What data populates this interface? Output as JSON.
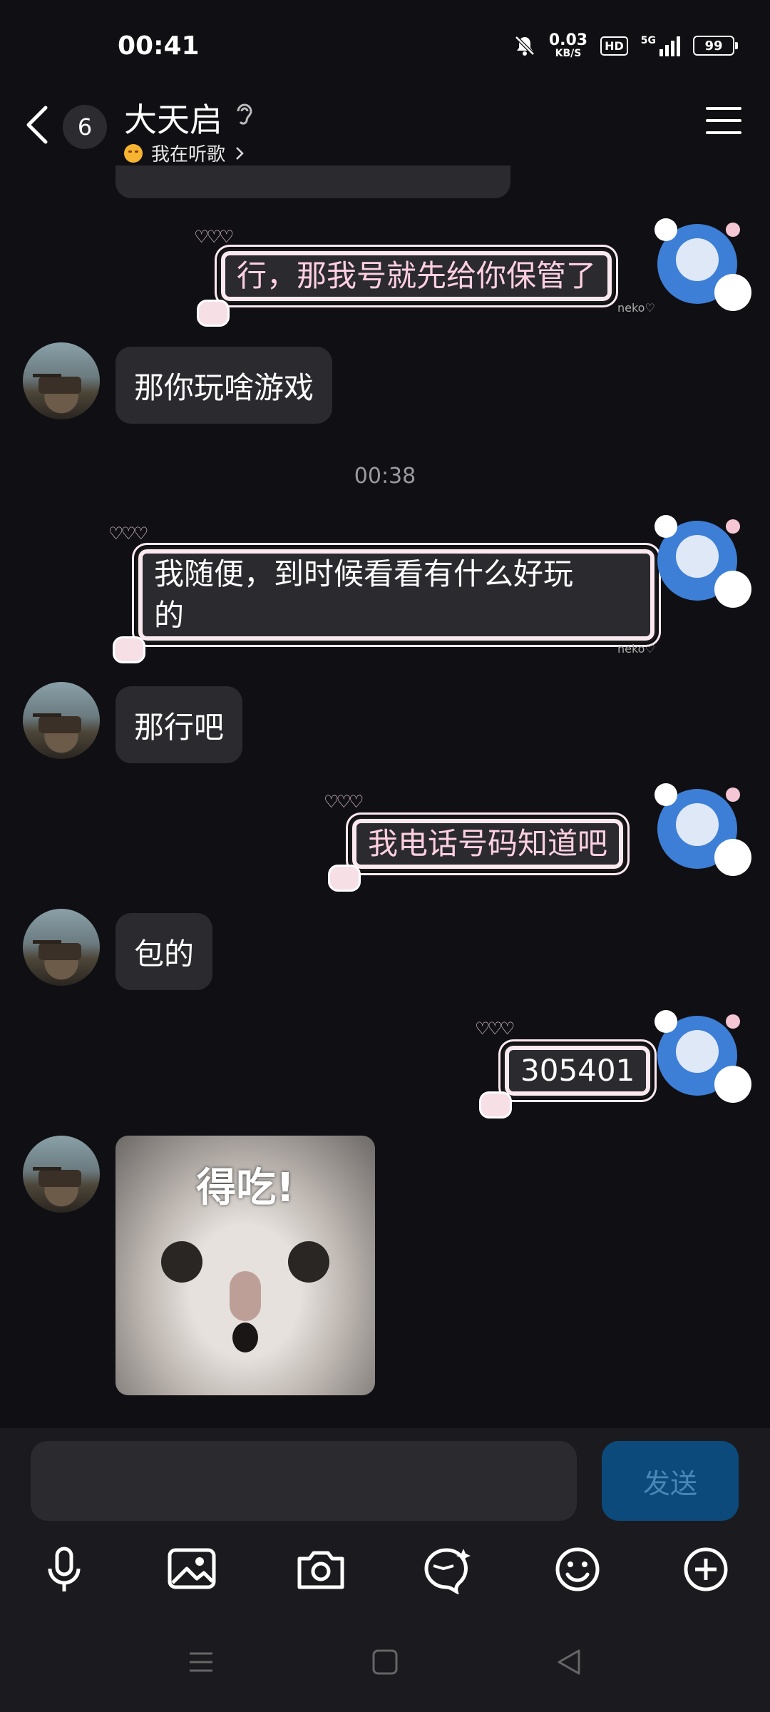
{
  "status_bar": {
    "time": "00:41",
    "net_speed": "0.03",
    "net_unit": "KB/S",
    "hd_label": "HD",
    "network_label": "5G",
    "battery": "99"
  },
  "header": {
    "unread_count": "6",
    "title": "大天启",
    "listening_text": "我在听歌"
  },
  "messages": {
    "out_1": "行，那我号就先给你保管了",
    "in_1": "那你玩啥游戏",
    "timestamp": "00:38",
    "out_2_line1": "我随便，到时候看看有什么好玩",
    "out_2_line2": "的",
    "in_2": "那行吧",
    "out_3": "我电话号码知道吧",
    "in_3": "包的",
    "out_4": "305401",
    "sticker_text": "得吃!"
  },
  "bubble_decor": {
    "hearts": "♡♡♡",
    "tag": "neko♡"
  },
  "input_bar": {
    "placeholder": "",
    "send_label": "发送"
  },
  "toolbar_icons": [
    "microphone-icon",
    "image-icon",
    "camera-icon",
    "ai-assistant-icon",
    "emoji-icon",
    "plus-icon"
  ],
  "colors": {
    "background": "#101014",
    "bubble_in": "#2a2a2f",
    "send_button": "#0b4a7a",
    "out_text": "#ffd0e0"
  }
}
